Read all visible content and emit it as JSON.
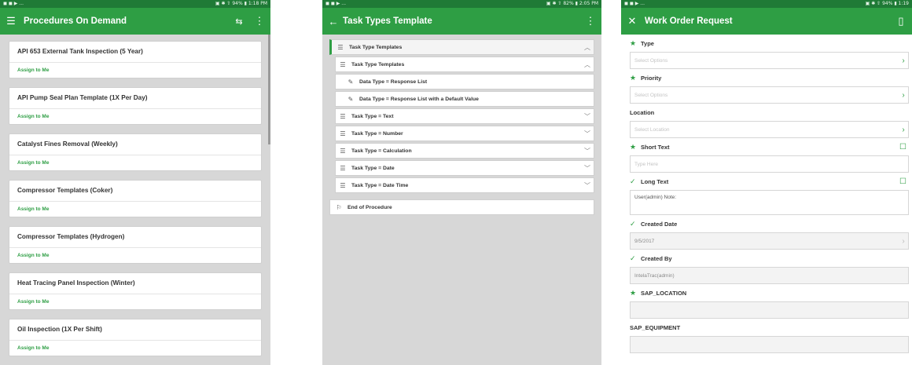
{
  "screen1": {
    "status": {
      "left": "◼ ◼ ▶ ...",
      "right": "▣ ✱ ⇧ 94% ▮ 1:18 PM"
    },
    "title": "Procedures On Demand",
    "action_label": "Assign to Me",
    "items": [
      {
        "title": "API 653 External Tank Inspection (5 Year)"
      },
      {
        "title": "API Pump Seal Plan Template (1X Per Day)"
      },
      {
        "title": "Catalyst Fines Removal (Weekly)"
      },
      {
        "title": "Compressor Templates (Coker)"
      },
      {
        "title": "Compressor Templates (Hydrogen)"
      },
      {
        "title": "Heat Tracing Panel Inspection (Winter)"
      },
      {
        "title": "Oil Inspection (1X Per Shift)"
      }
    ]
  },
  "screen2": {
    "status": {
      "left": "◼ ◼ ▶ ...",
      "right": "▣ ✱ ⇧ 82% ▮ 2:05 PM"
    },
    "title": "Task Types Template",
    "nodes": {
      "root": "Task Type Templates",
      "sub": "Task Type Templates",
      "dt_list": "Data Type = Response List",
      "dt_default": "Data Type = Response List with a Default Value",
      "text": "Task Type = Text",
      "number": "Task Type = Number",
      "calc": "Task Type = Calculation",
      "date": "Task Type = Date",
      "datetime": "Task Type = Date Time",
      "end": "End of Procedure"
    }
  },
  "screen3": {
    "status": {
      "left": "◼ ◼ ▶ ...",
      "right": "▣ ✱ ⇧ 94% ▮ 1:19"
    },
    "title": "Work Order Request",
    "fields": {
      "type": {
        "label": "Type",
        "placeholder": "Select Options"
      },
      "priority": {
        "label": "Priority",
        "placeholder": "Select Options"
      },
      "location": {
        "label": "Location",
        "placeholder": "Select Location"
      },
      "short_text": {
        "label": "Short Text",
        "placeholder": "Type Here"
      },
      "long_text": {
        "label": "Long Text",
        "value": "User(admin) Note:"
      },
      "created_date": {
        "label": "Created Date",
        "value": "9/5/2017"
      },
      "created_by": {
        "label": "Created By",
        "value": "IntelaTrac(admin)"
      },
      "sap_location": {
        "label": "SAP_LOCATION",
        "value": ""
      },
      "sap_equipment": {
        "label": "SAP_EQUIPMENT",
        "value": ""
      }
    }
  },
  "colors": {
    "primary": "#2e9e44",
    "status_bar": "#1f7a36",
    "background": "#d7d7d7"
  }
}
